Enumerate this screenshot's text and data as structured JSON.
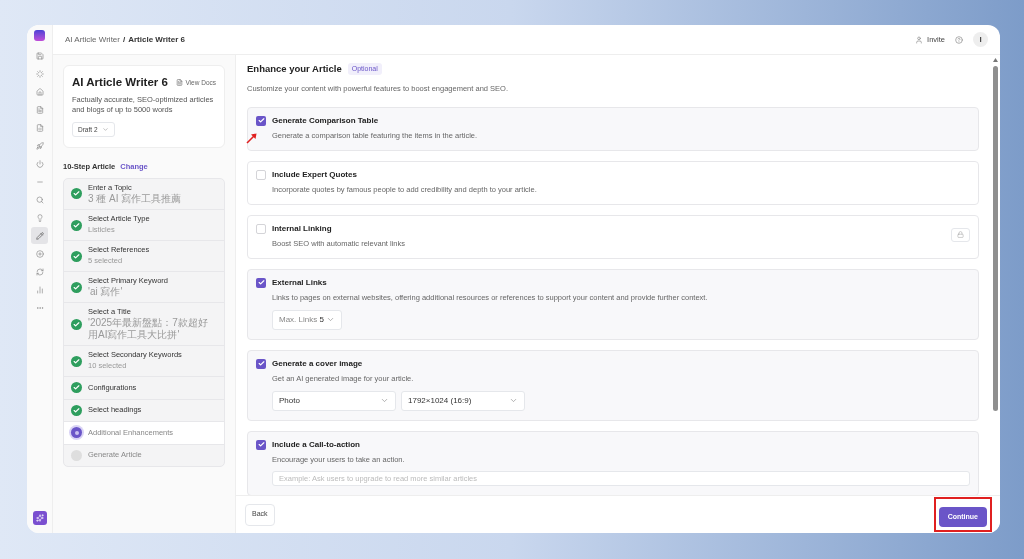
{
  "breadcrumb": {
    "parent": "AI Article Writer",
    "separator": "/",
    "current": "Article Writer 6"
  },
  "header": {
    "invite": "Invite"
  },
  "avatar": {
    "initial": "I"
  },
  "rail": [
    {
      "selected": false
    },
    {
      "selected": false
    },
    {
      "selected": false
    },
    {
      "selected": false
    },
    {
      "selected": false
    },
    {
      "selected": false
    },
    {
      "selected": false
    },
    {
      "selected": false
    },
    {
      "selected": false
    },
    {
      "selected": false
    },
    {
      "selected": true
    },
    {
      "selected": false
    },
    {
      "selected": false
    },
    {
      "selected": false
    },
    {
      "selected": false
    }
  ],
  "tool_card": {
    "title": "AI Article Writer 6",
    "docs_link": "View Docs",
    "description": "Factually accurate, SEO-optimized articles and blogs of up to 5000 words",
    "draft": "Draft 2"
  },
  "steps_heading": {
    "label": "10-Step Article",
    "action": "Change"
  },
  "steps": [
    {
      "title": "Enter a Topic",
      "subtitle": "3 種 AI 寫作工具推薦",
      "completed": true,
      "current": false
    },
    {
      "title": "Select Article Type",
      "subtitle": "Listicles",
      "completed": true,
      "current": false
    },
    {
      "title": "Select References",
      "subtitle": "5 selected",
      "completed": true,
      "current": false
    },
    {
      "title": "Select Primary Keyword",
      "subtitle": "'ai 寫作'",
      "completed": true,
      "current": false
    },
    {
      "title": "Select a Title",
      "subtitle": "'2025年最新盤點：7款超好用AI寫作工具大比拼'",
      "completed": true,
      "current": false
    },
    {
      "title": "Select Secondary Keywords",
      "subtitle": "10 selected",
      "completed": true,
      "current": false
    },
    {
      "title": "Configurations",
      "completed": true,
      "current": false
    },
    {
      "title": "Select headings",
      "completed": true,
      "current": false
    },
    {
      "title": "Additional Enhancements",
      "completed": false,
      "current": true
    },
    {
      "title": "Generate Article",
      "completed": false,
      "current": false
    }
  ],
  "section": {
    "title": "Enhance your Article",
    "badge": "Optional",
    "description": "Customize your content with powerful features to boost engagement and SEO."
  },
  "features": [
    {
      "kind": "plain",
      "title": "Generate Comparison Table",
      "description": "Generate a comparison table featuring the items in the article.",
      "checked": true,
      "annotated": true
    },
    {
      "kind": "plain",
      "title": "Include Expert Quotes",
      "description": "Incorporate quotes by famous people to add credibility and depth to your article.",
      "checked": false,
      "annotated": false
    },
    {
      "kind": "locked",
      "title": "Internal Linking",
      "description": "Boost SEO with automatic relevant links",
      "checked": false,
      "annotated": false
    },
    {
      "kind": "max_links",
      "title": "External Links",
      "description": "Links to pages on external websites, offering additional resources or references to support your content and provide further context.",
      "checked": true,
      "annotated": false,
      "select_label": "Max. Links",
      "select_value": "5"
    },
    {
      "kind": "cover",
      "title": "Generate a cover image",
      "description": "Get an AI generated image for your article.",
      "checked": true,
      "annotated": false,
      "style": "Photo",
      "size": "1792×1024 (16:9)"
    },
    {
      "kind": "cta",
      "title": "Include a Call-to-action",
      "description": "Encourage your users to take an action.",
      "checked": true,
      "annotated": false,
      "placeholder": "Example: Ask users to upgrade to read more similar articles"
    }
  ],
  "footer": {
    "back": "Back",
    "continue": "Continue",
    "continue_highlighted": true
  }
}
